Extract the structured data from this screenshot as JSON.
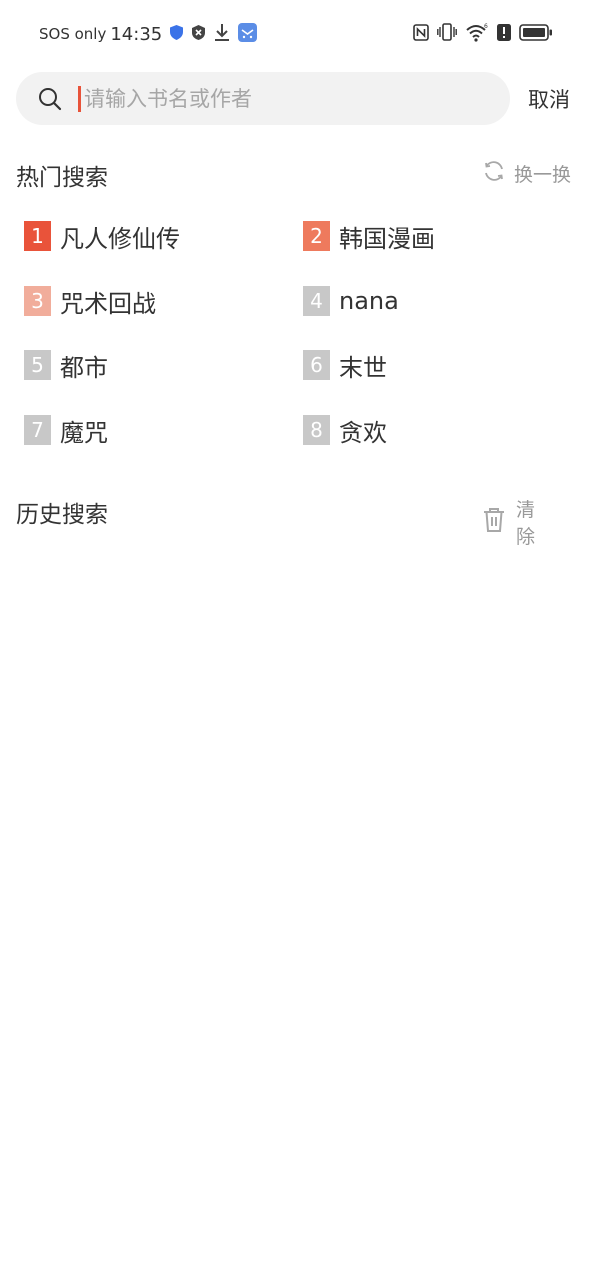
{
  "status_bar": {
    "carrier": "SOS only",
    "time": "14:35",
    "icons_left": [
      "shield-icon",
      "blocked-icon",
      "download-icon",
      "app-icon"
    ],
    "icons_right": [
      "nfc-icon",
      "vibrate-icon",
      "wifi-icon",
      "alert-icon",
      "battery-icon"
    ]
  },
  "search": {
    "placeholder": "请输入书名或作者",
    "value": "",
    "cancel_label": "取消"
  },
  "hot": {
    "title": "热门搜索",
    "refresh_label": "换一换",
    "items": [
      {
        "rank": "1",
        "label": "凡人修仙传",
        "color": "#e9533a"
      },
      {
        "rank": "2",
        "label": "韩国漫画",
        "color": "#ee7a5d"
      },
      {
        "rank": "3",
        "label": "咒术回战",
        "color": "#f1ad9b"
      },
      {
        "rank": "4",
        "label": "nana",
        "color": "#c8c8c8"
      },
      {
        "rank": "5",
        "label": "都市",
        "color": "#c8c8c8"
      },
      {
        "rank": "6",
        "label": "末世",
        "color": "#c8c8c8"
      },
      {
        "rank": "7",
        "label": "魔咒",
        "color": "#c8c8c8"
      },
      {
        "rank": "8",
        "label": "贪欢",
        "color": "#c8c8c8"
      }
    ]
  },
  "history": {
    "title": "历史搜索",
    "clear_label": "清除"
  },
  "colors": {
    "accent": "#e9533a",
    "search_bg": "#f2f2f2",
    "muted_text": "#999999"
  }
}
